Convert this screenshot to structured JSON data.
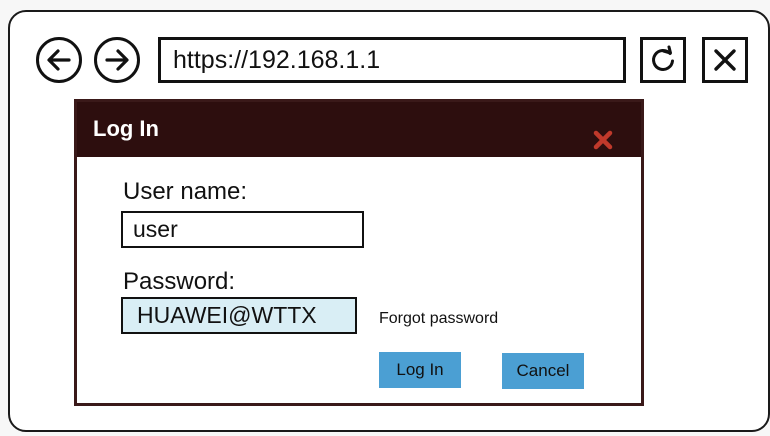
{
  "browser": {
    "url": "https://192.168.1.1",
    "icons": {
      "back": "arrow-left-icon",
      "forward": "arrow-right-icon",
      "refresh": "refresh-icon",
      "close": "close-icon"
    }
  },
  "dialog": {
    "title": "Log In",
    "close_icon": "close-icon",
    "username_label": "User name:",
    "username_value": "user",
    "password_label": "Password:",
    "password_value": "HUAWEI@WTTX",
    "forgot_link": "Forgot password",
    "login_button": "Log In",
    "cancel_button": "Cancel"
  },
  "colors": {
    "titlebar": "#2d0e0e",
    "close_icon": "#c0392b",
    "button": "#4b9fd3",
    "password_field_bg": "#d9eef5"
  }
}
